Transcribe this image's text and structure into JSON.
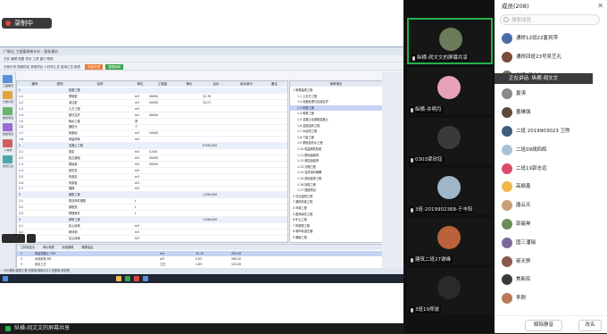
{
  "recording": {
    "label": "录制中"
  },
  "app": {
    "title_bar": "广联达 工程量清单计价 - 投标报价",
    "toolbar_row1": "文件 编辑 视图 项目 工具 窗口 帮助",
    "toolbar_row2": "分部分项 措施项目 其他项目 人材机汇总 费用汇总 报表",
    "tag_orange": "分部分项",
    "tag_green": "整理清单",
    "nav_items": [
      "工程概况",
      "分部分项",
      "措施项目",
      "其他项目",
      "人材机",
      "费用汇总"
    ],
    "table_headers": [
      "编号",
      "类别",
      "名称",
      "单位",
      "工程量",
      "单价",
      "合价",
      "综合单价",
      "备注"
    ],
    "table_rows": [
      {
        "code": "1",
        "name": "桩基工程",
        "unit": "",
        "qty": "",
        "price": ""
      },
      {
        "code": "1.1",
        "name": "预制桩",
        "unit": "m3",
        "qty": "50000",
        "price": "22.76"
      },
      {
        "code": "1.2",
        "name": "灌注桩",
        "unit": "m3",
        "qty": "50000",
        "price": "19.27"
      },
      {
        "code": "1.3",
        "name": "土方工程",
        "unit": "m3",
        "qty": "",
        "price": ""
      },
      {
        "code": "1.4",
        "name": "基坑支护",
        "unit": "m2",
        "qty": "40000",
        "price": ""
      },
      {
        "code": "1.5",
        "name": "降水工程",
        "unit": "项",
        "qty": "",
        "price": ""
      },
      {
        "code": "1.6",
        "name": "截桩头",
        "unit": "个",
        "qty": "",
        "price": ""
      },
      {
        "code": "1.7",
        "name": "砖基础",
        "unit": "m3",
        "qty": "10000",
        "price": ""
      },
      {
        "code": "1.8",
        "name": "零星砌体",
        "unit": "m3",
        "qty": "",
        "price": ""
      },
      {
        "code": "2",
        "name": "混凝土工程",
        "unit": "",
        "qty": "",
        "price": "9,550,000"
      },
      {
        "code": "2.1",
        "name": "垫层",
        "unit": "m3",
        "qty": "4,500",
        "price": ""
      },
      {
        "code": "2.2",
        "name": "独立基础",
        "unit": "m3",
        "qty": "50000",
        "price": ""
      },
      {
        "code": "2.3",
        "name": "基础梁",
        "unit": "m3",
        "qty": "50000",
        "price": ""
      },
      {
        "code": "2.4",
        "name": "矩形柱",
        "unit": "m3",
        "qty": "",
        "price": ""
      },
      {
        "code": "2.5",
        "name": "构造柱",
        "unit": "m3",
        "qty": "",
        "price": ""
      },
      {
        "code": "2.6",
        "name": "有梁板",
        "unit": "m3",
        "qty": "",
        "price": ""
      },
      {
        "code": "2.7",
        "name": "楼梯",
        "unit": "m2",
        "qty": "",
        "price": ""
      },
      {
        "code": "3",
        "name": "钢筋工程",
        "unit": "",
        "qty": "",
        "price": "1,056,000"
      },
      {
        "code": "3.1",
        "name": "现浇构件钢筋",
        "unit": "t",
        "qty": "",
        "price": ""
      },
      {
        "code": "3.2",
        "name": "钢筋笼",
        "unit": "t",
        "qty": "",
        "price": ""
      },
      {
        "code": "3.3",
        "name": "预埋铁件",
        "unit": "t",
        "qty": "",
        "price": ""
      },
      {
        "code": "4",
        "name": "砌筑工程",
        "unit": "",
        "qty": "",
        "price": "1,056,000"
      },
      {
        "code": "4.1",
        "name": "实心砖墙",
        "unit": "m3",
        "qty": "",
        "price": ""
      },
      {
        "code": "4.2",
        "name": "砌块墙",
        "unit": "m3",
        "qty": "",
        "price": ""
      },
      {
        "code": "4.3",
        "name": "空心砖墙",
        "unit": "m3",
        "qty": "",
        "price": ""
      }
    ],
    "tree_header": "清单指引",
    "tree_rows": [
      "1 房屋建筑工程",
      "1.1 土石方工程",
      "1.2 地基处理与边坡支护",
      "1.3 桩基工程",
      "1.4 砌筑工程",
      "1.5 混凝土及钢筋混凝土",
      "1.6 金属结构工程",
      "1.7 木结构工程",
      "1.8 门窗工程",
      "1.9 屋面及防水工程",
      "1.10 保温隔热防腐",
      "1.11 楼地面装饰",
      "1.12 墙柱面装饰",
      "1.13 天棚工程",
      "1.14 油漆涂料裱糊",
      "1.15 其他装饰工程",
      "1.16 拆除工程",
      "1.17 措施项目",
      "2 仿古建筑工程",
      "3 通用安装工程",
      "4 市政工程",
      "5 园林绿化工程",
      "6 矿山工程",
      "7 构筑物工程",
      "8 城市轨道交通",
      "9 爆破工程"
    ],
    "bottom_tabs": [
      "工料机显示",
      "单价构成",
      "标准换算",
      "换算信息"
    ],
    "bottom_rows": [
      {
        "code": "1",
        "name": "商品混凝土 C30",
        "unit": "m3",
        "qty": "10.15",
        "price": "450.00"
      },
      {
        "code": "2",
        "name": "水泥砂浆 M5",
        "unit": "m3",
        "qty": "0.02",
        "price": "280.00"
      },
      {
        "code": "3",
        "name": "综合工日",
        "unit": "工日",
        "qty": "1.85",
        "price": "120.00"
      }
    ],
    "status": "计价程序:建筑工程  清单库:国标2013  定额库:省定额"
  },
  "sharer_bar": {
    "label": "纵横-阎文文的屏幕共享"
  },
  "video_tiles": [
    {
      "name": "纵横-阎文文的屏幕共享",
      "active": true,
      "color": "#6b7b5a"
    },
    {
      "name": "纵横-许明月",
      "active": false,
      "color": "#e7a2b8"
    },
    {
      "name": "0303梁欣钰",
      "active": false,
      "color": "#3a3a3a"
    },
    {
      "name": "3班-2019902368-于丰阳",
      "active": false,
      "color": "#9fb6c9"
    },
    {
      "name": "建筑二班27谢峰",
      "active": false,
      "color": "#b8613b"
    },
    {
      "name": "3班19郑波",
      "active": false,
      "color": "#2a2a2a"
    }
  ],
  "members": {
    "header": "成员(208)",
    "search_placeholder": "搜索成员",
    "speaking": "正在讲话: 纵横-阎文文",
    "list": [
      {
        "name": "通桥12班22夏珂萍",
        "color": "#4b6ea9"
      },
      {
        "name": "通桥四班23号吴艺孔",
        "color": "#7a4b3a"
      },
      {
        "name": "纵横-阎文文",
        "color": "#6b7b5a"
      },
      {
        "name": "夏涛",
        "color": "#8a8a8a"
      },
      {
        "name": "董琳强",
        "color": "#5b4a3b"
      },
      {
        "name": "二班 2019903023 卫然",
        "color": "#3d5d7a"
      },
      {
        "name": "二班09胡四辉",
        "color": "#a4c3d8"
      },
      {
        "name": "二班19郭志远",
        "color": "#d94b6b"
      },
      {
        "name": "高颖鑫",
        "color": "#f2b84b"
      },
      {
        "name": "唐云天",
        "color": "#c9a07a"
      },
      {
        "name": "郭晨昊",
        "color": "#6a8c5a"
      },
      {
        "name": "国三潘瑞",
        "color": "#7b6b9a"
      },
      {
        "name": "郝天骅",
        "color": "#8b5a4a"
      },
      {
        "name": "焦新民",
        "color": "#3b3b3b"
      },
      {
        "name": "李刚",
        "color": "#b87a5a"
      }
    ],
    "btn_unmute": "解除静音",
    "btn_rename": "改名"
  }
}
